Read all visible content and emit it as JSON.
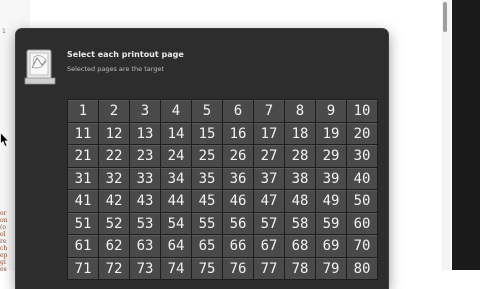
{
  "dialog": {
    "title": "Select each printout page",
    "subtitle": "Selected pages are the target"
  },
  "pages": [
    1,
    2,
    3,
    4,
    5,
    6,
    7,
    8,
    9,
    10,
    11,
    12,
    13,
    14,
    15,
    16,
    17,
    18,
    19,
    20,
    21,
    22,
    23,
    24,
    25,
    26,
    27,
    28,
    29,
    30,
    31,
    32,
    33,
    34,
    35,
    36,
    37,
    38,
    39,
    40,
    41,
    42,
    43,
    44,
    45,
    46,
    47,
    48,
    49,
    50,
    51,
    52,
    53,
    54,
    55,
    56,
    57,
    58,
    59,
    60,
    61,
    62,
    63,
    64,
    65,
    66,
    67,
    68,
    69,
    70,
    71,
    72,
    73,
    74,
    75,
    76,
    77,
    78,
    79,
    80
  ],
  "background": {
    "tick_text": "1",
    "fragments": [
      "or",
      "on",
      "(o",
      "ol",
      "re",
      "ch",
      "ep",
      "gi",
      "es"
    ]
  },
  "colors": {
    "dialog_bg": "#2d2d2d",
    "cell_bg": "#4a4a4a",
    "cell_text": "#f2f2f2"
  }
}
